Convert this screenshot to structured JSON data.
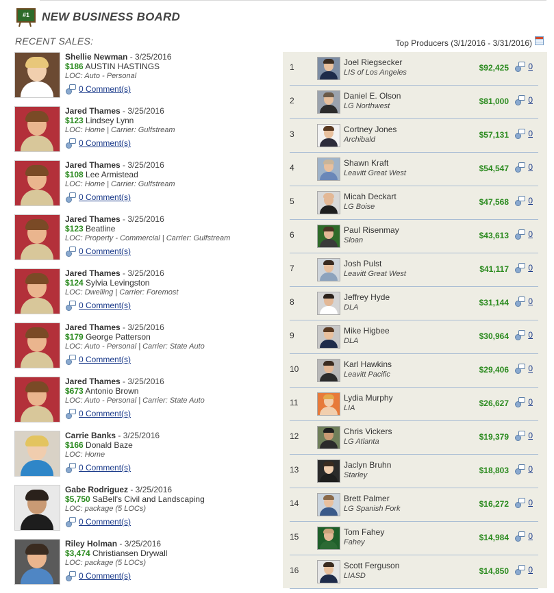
{
  "header": {
    "badge": "#1",
    "title": "NEW BUSINESS BOARD"
  },
  "recent_label": "RECENT SALES:",
  "top_label": "Top Producers (3/1/2016 - 3/31/2016)",
  "sales": [
    {
      "name": "Shellie Newman",
      "date": " - 3/25/2016",
      "amount": "$186",
      "client": " AUSTIN HASTINGS",
      "loc": "LOC: Auto - Personal",
      "comments": "0 Comment(s)"
    },
    {
      "name": "Jared Thames",
      "date": " - 3/25/2016",
      "amount": "$123",
      "client": " Lindsey Lynn",
      "loc": "LOC: Home | Carrier: Gulfstream",
      "comments": "0 Comment(s)"
    },
    {
      "name": "Jared Thames",
      "date": " - 3/25/2016",
      "amount": "$108",
      "client": " Lee Armistead",
      "loc": "LOC: Home | Carrier: Gulfstream",
      "comments": "0 Comment(s)"
    },
    {
      "name": "Jared Thames",
      "date": " - 3/25/2016",
      "amount": "$123",
      "client": " Beatline",
      "loc": "LOC: Property - Commercial | Carrier: Gulfstream",
      "comments": "0 Comment(s)"
    },
    {
      "name": "Jared Thames",
      "date": " - 3/25/2016",
      "amount": "$124",
      "client": " Sylvia Levingston",
      "loc": "LOC: Dwelling | Carrier: Foremost",
      "comments": "0 Comment(s)"
    },
    {
      "name": "Jared Thames",
      "date": " - 3/25/2016",
      "amount": "$179",
      "client": " George Patterson",
      "loc": "LOC: Auto - Personal | Carrier: State Auto",
      "comments": "0 Comment(s)"
    },
    {
      "name": "Jared Thames",
      "date": " - 3/25/2016",
      "amount": "$673",
      "client": " Antonio Brown",
      "loc": "LOC: Auto - Personal | Carrier: State Auto",
      "comments": "0 Comment(s)"
    },
    {
      "name": "Carrie Banks",
      "date": " - 3/25/2016",
      "amount": "$166",
      "client": " Donald Baze",
      "loc": "LOC: Home",
      "comments": "0 Comment(s)"
    },
    {
      "name": "Gabe Rodriguez",
      "date": " - 3/25/2016",
      "amount": "$5,750",
      "client": " SaBell's Civil and Landscaping",
      "loc": "LOC: package (5 LOCs)",
      "comments": "0 Comment(s)"
    },
    {
      "name": "Riley Holman",
      "date": " - 3/25/2016",
      "amount": "$3,474",
      "client": " Christiansen Drywall",
      "loc": "LOC: package (5 LOCs)",
      "comments": "0 Comment(s)"
    }
  ],
  "producers": [
    {
      "rank": "1",
      "name": "Joel Riegsecker",
      "agency": "LIS of Los Angeles",
      "total": "$92,425",
      "comments": "0"
    },
    {
      "rank": "2",
      "name": "Daniel E. Olson",
      "agency": "LG Northwest",
      "total": "$81,000",
      "comments": "0"
    },
    {
      "rank": "3",
      "name": "Cortney Jones",
      "agency": "Archibald",
      "total": "$57,131",
      "comments": "0"
    },
    {
      "rank": "4",
      "name": "Shawn Kraft",
      "agency": "Leavitt Great West",
      "total": "$54,547",
      "comments": "0"
    },
    {
      "rank": "5",
      "name": "Micah Deckart",
      "agency": "LG Boise",
      "total": "$47,568",
      "comments": "0"
    },
    {
      "rank": "6",
      "name": "Paul Risenmay",
      "agency": "Sloan",
      "total": "$43,613",
      "comments": "0"
    },
    {
      "rank": "7",
      "name": "Josh Pulst",
      "agency": "Leavitt Great West",
      "total": "$41,117",
      "comments": "0"
    },
    {
      "rank": "8",
      "name": "Jeffrey Hyde",
      "agency": "DLA",
      "total": "$31,144",
      "comments": "0"
    },
    {
      "rank": "9",
      "name": "Mike Higbee",
      "agency": "DLA",
      "total": "$30,964",
      "comments": "0"
    },
    {
      "rank": "10",
      "name": "Karl Hawkins",
      "agency": "Leavitt Pacific",
      "total": "$29,406",
      "comments": "0"
    },
    {
      "rank": "11",
      "name": "Lydia Murphy",
      "agency": "LIA",
      "total": "$26,627",
      "comments": "0"
    },
    {
      "rank": "12",
      "name": "Chris Vickers",
      "agency": "LG Atlanta",
      "total": "$19,379",
      "comments": "0"
    },
    {
      "rank": "13",
      "name": "Jaclyn Bruhn",
      "agency": "Starley",
      "total": "$18,803",
      "comments": "0"
    },
    {
      "rank": "14",
      "name": "Brett Palmer",
      "agency": "LG Spanish Fork",
      "total": "$16,272",
      "comments": "0"
    },
    {
      "rank": "15",
      "name": "Tom Fahey",
      "agency": "Fahey",
      "total": "$14,984",
      "comments": "0"
    },
    {
      "rank": "16",
      "name": "Scott Ferguson",
      "agency": "LIASD",
      "total": "$14,850",
      "comments": "0"
    }
  ],
  "colors": {
    "amount_green": "#2a8a1e",
    "link_blue": "#1a3a8a",
    "panel_bg": "#eeede4",
    "row_divider": "#a9bdd4"
  }
}
